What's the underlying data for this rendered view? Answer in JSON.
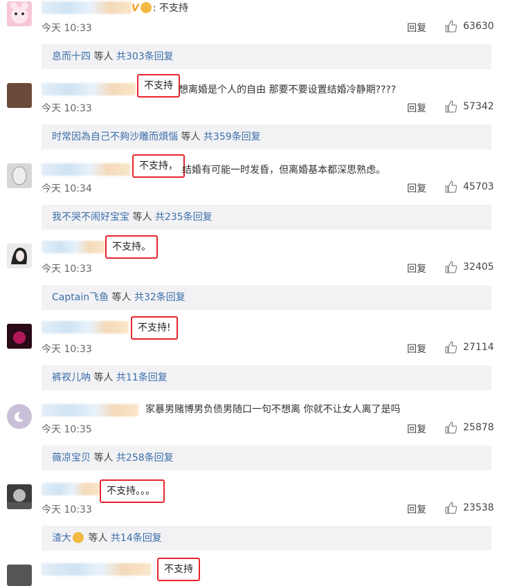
{
  "comments": [
    {
      "text": "不支持",
      "time": "今天 10:33",
      "reply": "回复",
      "likes": "63630",
      "sub": {
        "nick": "息而十四",
        "mid": "等人",
        "count": "共303条回复"
      }
    },
    {
      "text_highlight": "不支持",
      "text": "想离婚是个人的自由 那要不要设置结婚冷静期????",
      "time": "今天 10:33",
      "reply": "回复",
      "likes": "57342",
      "sub": {
        "nick": "时常因為自己不夠沙雕而煩惱",
        "mid": "等人",
        "count": "共359条回复"
      }
    },
    {
      "text_highlight": "不支持，",
      "text": "结婚有可能一时发昏，但离婚基本都深思熟虑。",
      "time": "今天 10:34",
      "reply": "回复",
      "likes": "45703",
      "sub": {
        "nick": "我不哭不闹好宝宝",
        "mid": "等人",
        "count": "共235条回复"
      }
    },
    {
      "text_highlight": "不支持。",
      "time": "今天 10:33",
      "reply": "回复",
      "likes": "32405",
      "sub": {
        "nick": "Captain飞鱼",
        "mid": "等人",
        "count": "共32条回复"
      }
    },
    {
      "text_highlight": "不支持!",
      "time": "今天 10:33",
      "reply": "回复",
      "likes": "27114",
      "sub": {
        "nick": "裤衩儿呐",
        "mid": "等人",
        "count": "共11条回复"
      }
    },
    {
      "text": "家暴男赌博男负债男随口一句不想离 你就不让女人离了是吗",
      "time": "今天 10:35",
      "reply": "回复",
      "likes": "25878",
      "sub": {
        "nick": "薇凉宝贝",
        "mid": "等人",
        "count": "共258条回复"
      }
    },
    {
      "text_highlight": "不支持。。。",
      "time": "今天 10:33",
      "reply": "回复",
      "likes": "23538",
      "sub": {
        "nick": "渣大",
        "mid": "等人",
        "count": "共14条回复"
      }
    },
    {
      "text_highlight": "不支持"
    }
  ],
  "colors": {
    "highlight_border": "#e8242c",
    "link": "#3b6ea8",
    "sub_bg": "#f2f2f5"
  }
}
